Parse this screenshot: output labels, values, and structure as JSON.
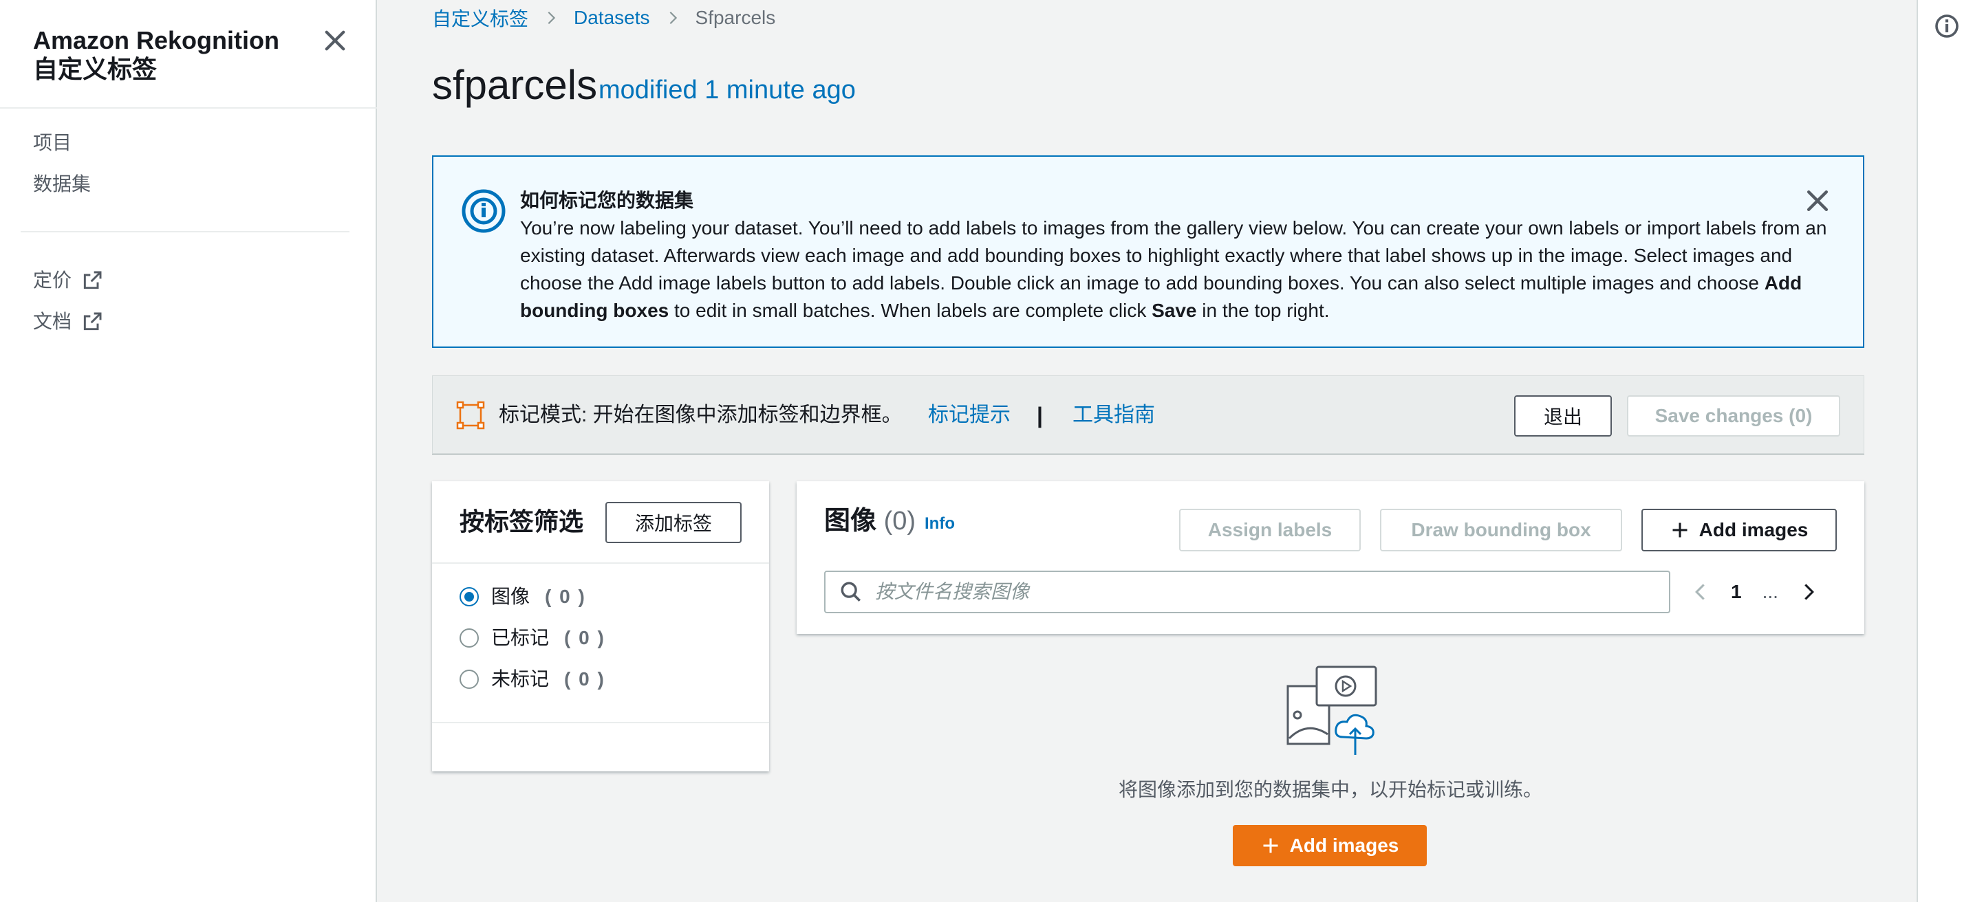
{
  "sidebar": {
    "title_line1": "Amazon Rekognition",
    "title_line2": "自定义标签",
    "nav": [
      {
        "label": "项目"
      },
      {
        "label": "数据集"
      }
    ],
    "external": [
      {
        "label": "定价",
        "icon": "external-link-icon"
      },
      {
        "label": "文档",
        "icon": "external-link-icon"
      }
    ]
  },
  "breadcrumb": [
    "自定义标签",
    "Datasets",
    "Sfparcels"
  ],
  "header": {
    "title": "sfparcels",
    "subtitle": "modified 1 minute ago"
  },
  "alert": {
    "title": "如何标记您的数据集",
    "body_1": "You’re now labeling your dataset. You’ll need to add labels to images from the gallery view below. You can create your own labels or import labels from an existing dataset. Afterwards view each image and add bounding boxes to highlight exactly where that label shows up in the image. Select images and choose the Add image labels button to add labels. Double click an image to add bounding boxes. You can also select multiple images and choose ",
    "body_bold_1": "Add bounding boxes",
    "body_2": " to edit in small batches. When labels are complete click ",
    "body_bold_2": "Save",
    "body_3": " in the top right."
  },
  "mode_bar": {
    "text": "标记模式: 开始在图像中添加标签和边界框。",
    "link_tips": "标记提示",
    "separator": "|",
    "link_guide": "工具指南",
    "exit_label": "退出",
    "save_label": "Save changes (0)"
  },
  "filter": {
    "title": "按标签筛选",
    "add_label": "添加标签",
    "options": [
      {
        "label": "图像",
        "count": "( 0 )",
        "selected": true
      },
      {
        "label": "已标记",
        "count": "( 0 )",
        "selected": false
      },
      {
        "label": "未标记",
        "count": "( 0 )",
        "selected": false
      }
    ]
  },
  "images": {
    "title": "图像",
    "count": "(0)",
    "info": "Info",
    "assign_labels": "Assign labels",
    "draw_bbox": "Draw bounding box",
    "add_images": "Add images",
    "search_placeholder": "按文件名搜索图像",
    "page": "1",
    "ellipsis": "..."
  },
  "empty_state": {
    "text": "将图像添加到您的数据集中，以开始标记或训练。",
    "button": "Add images"
  },
  "colors": {
    "link": "#0073bb",
    "primary_button": "#ec7211",
    "mode_icon": "#ec7211"
  }
}
